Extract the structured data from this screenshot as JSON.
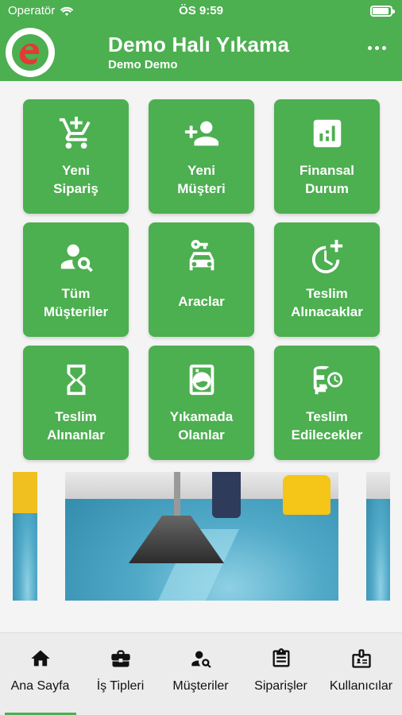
{
  "status_bar": {
    "carrier": "Operatör",
    "time": "ÖS 9:59",
    "battery_level": 0.9
  },
  "header": {
    "title": "Demo Halı Yıkama",
    "subtitle": "Demo Demo",
    "logo_letter": "e"
  },
  "tiles": [
    {
      "label": "Yeni\nSipariş",
      "icon": "cart-add-icon"
    },
    {
      "label": "Yeni\nMüşteri",
      "icon": "person-add-icon"
    },
    {
      "label": "Finansal\nDurum",
      "icon": "chart-icon"
    },
    {
      "label": "Tüm\nMüşteriler",
      "icon": "person-search-icon"
    },
    {
      "label": "Araclar",
      "icon": "car-icon"
    },
    {
      "label": "Teslim\nAlınacaklar",
      "icon": "clock-add-icon"
    },
    {
      "label": "Teslim\nAlınanlar",
      "icon": "hourglass-icon"
    },
    {
      "label": "Yıkamada\nOlanlar",
      "icon": "washing-machine-icon"
    },
    {
      "label": "Teslim\nEdilecekler",
      "icon": "bus-clock-icon"
    }
  ],
  "tabs": [
    {
      "label": "Ana Sayfa",
      "icon": "home-icon",
      "active": true
    },
    {
      "label": "İş Tipleri",
      "icon": "briefcase-icon",
      "active": false
    },
    {
      "label": "Müşteriler",
      "icon": "person-search-icon",
      "active": false
    },
    {
      "label": "Siparişler",
      "icon": "clipboard-icon",
      "active": false
    },
    {
      "label": "Kullanıcılar",
      "icon": "badge-icon",
      "active": false
    }
  ],
  "colors": {
    "accent": "#4caf50",
    "logo_red": "#e53935"
  }
}
